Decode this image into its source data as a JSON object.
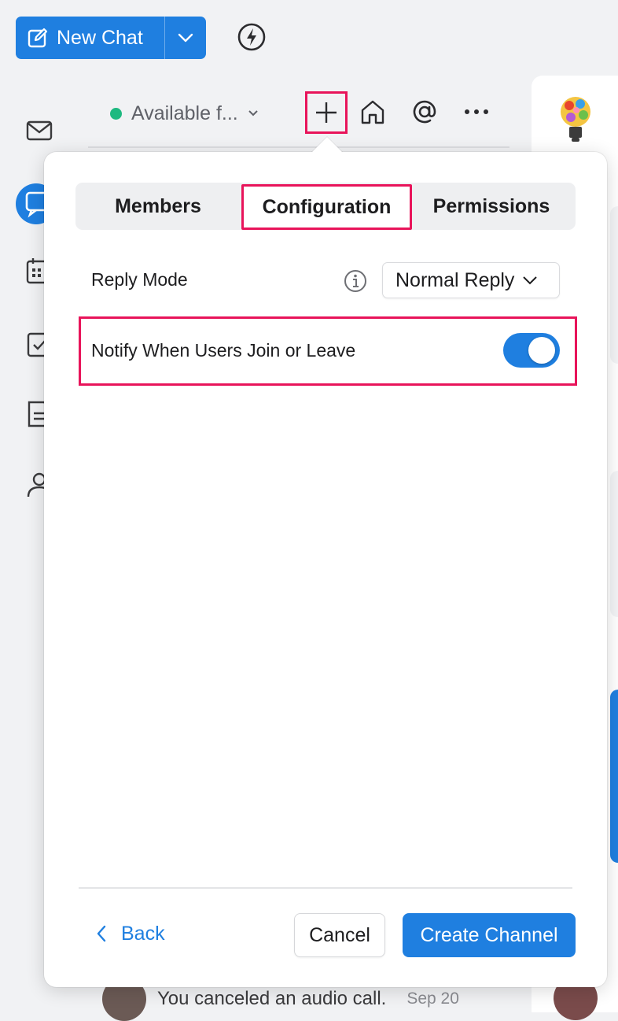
{
  "toolbar": {
    "new_chat_label": "New Chat"
  },
  "header": {
    "status_text": "Available f...",
    "status_color": "#1eb980"
  },
  "popover": {
    "tabs": [
      {
        "label": "Members",
        "active": false
      },
      {
        "label": "Configuration",
        "active": true
      },
      {
        "label": "Permissions",
        "active": false
      }
    ],
    "reply_mode": {
      "label": "Reply Mode",
      "value": "Normal Reply"
    },
    "notify": {
      "label": "Notify When Users Join or Leave",
      "enabled": true
    },
    "footer": {
      "back_label": "Back",
      "cancel_label": "Cancel",
      "create_label": "Create Channel"
    }
  },
  "background": {
    "last_message": "You canceled an audio call.",
    "last_message_date": "Sep 20"
  },
  "colors": {
    "accent": "#1f7fe0",
    "highlight": "#e8145a"
  }
}
